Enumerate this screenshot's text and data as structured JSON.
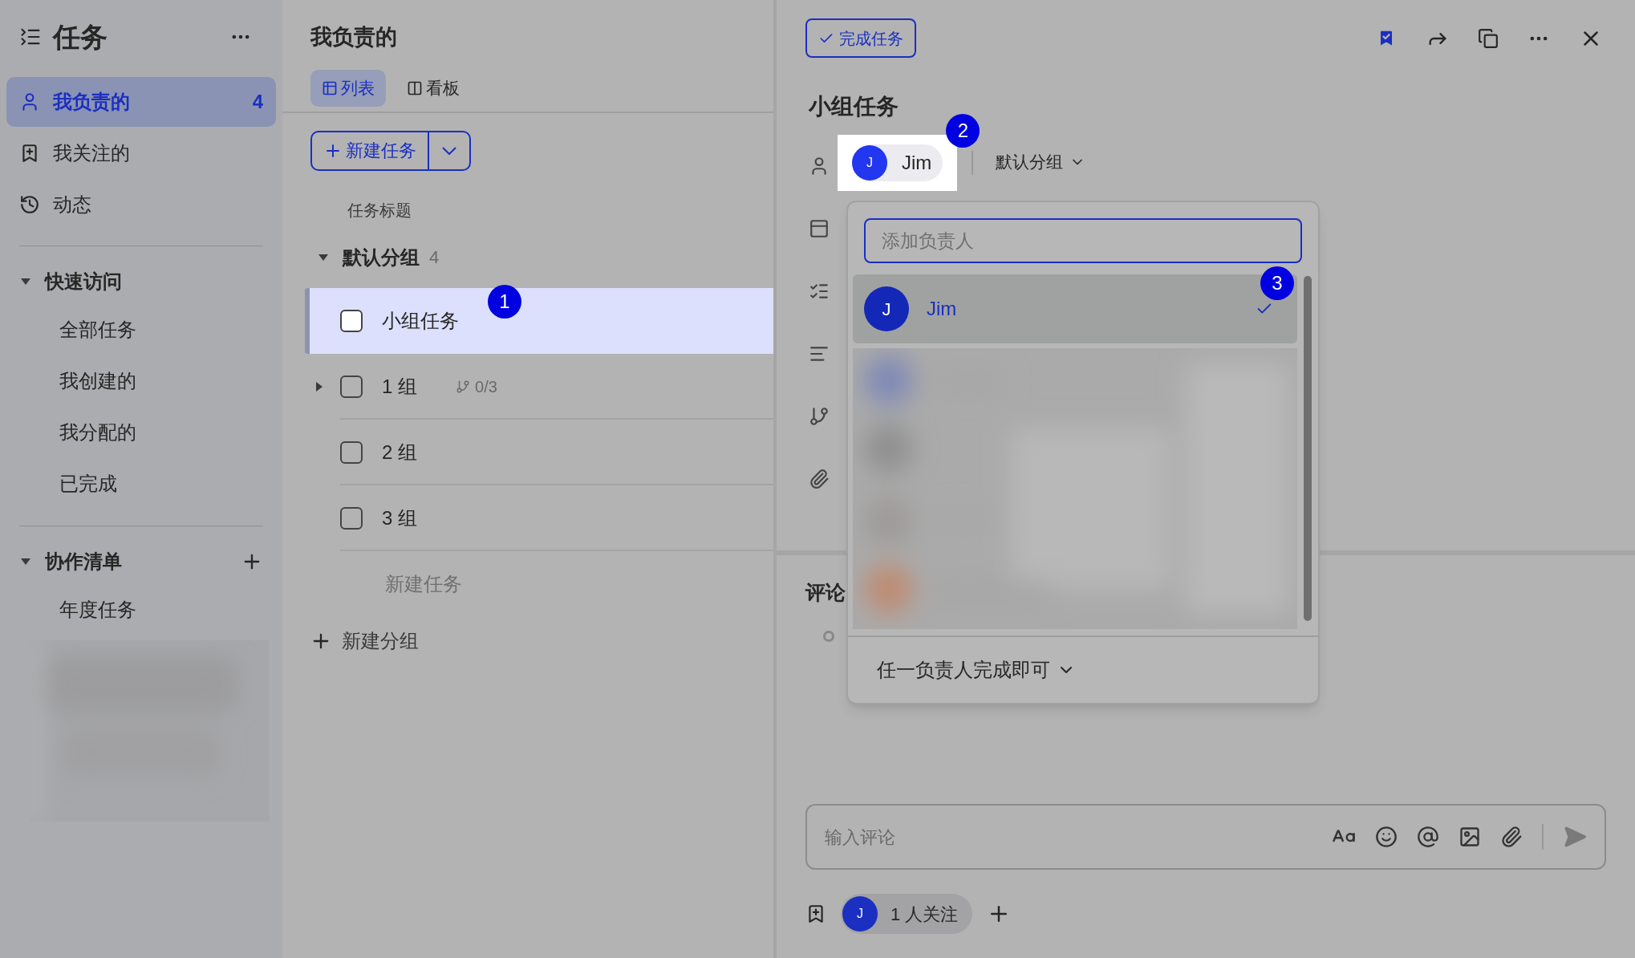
{
  "sidebar": {
    "title": "任务",
    "nav": [
      {
        "label": "我负责的",
        "count": "4",
        "selected": true
      },
      {
        "label": "我关注的",
        "selected": false
      },
      {
        "label": "动态",
        "selected": false
      }
    ],
    "sections": [
      {
        "title": "快速访问",
        "expanded": true,
        "can_add": false,
        "items": [
          "全部任务",
          "我创建的",
          "我分配的",
          "已完成"
        ]
      },
      {
        "title": "协作清单",
        "expanded": true,
        "can_add": true,
        "items": [
          "年度任务"
        ]
      }
    ]
  },
  "list": {
    "title": "我负责的",
    "tabs": [
      {
        "label": "列表",
        "selected": true
      },
      {
        "label": "看板",
        "selected": false
      }
    ],
    "new_task_button": "新建任务",
    "column_header": "任务标题",
    "group": {
      "name": "默认分组",
      "count": "4",
      "expanded": true
    },
    "tasks": [
      {
        "title": "小组任务",
        "selected": true,
        "checked": false,
        "has_subtasks": false,
        "badge": "1"
      },
      {
        "title": "1 组",
        "selected": false,
        "checked": false,
        "has_subtasks": true,
        "subtasks": "0/3"
      },
      {
        "title": "2 组",
        "selected": false,
        "checked": false,
        "has_subtasks": false
      },
      {
        "title": "3 组",
        "selected": false,
        "checked": false,
        "has_subtasks": false
      }
    ],
    "new_task": "新建任务",
    "new_group": "新建分组"
  },
  "detail": {
    "complete_button": "完成任务",
    "title": "小组任务",
    "assignee": {
      "initial": "J",
      "name": "Jim",
      "badge": "2"
    },
    "group_select": "默认分组",
    "comments_title": "评论",
    "comment_placeholder": "输入评论",
    "followers": {
      "initial": "J",
      "label": "1 人关注"
    }
  },
  "assignee_dropdown": {
    "placeholder": "添加负责人",
    "options": [
      {
        "initial": "J",
        "name": "Jim",
        "selected": true,
        "badge": "3"
      }
    ],
    "mode": "任一负责人完成即可"
  }
}
